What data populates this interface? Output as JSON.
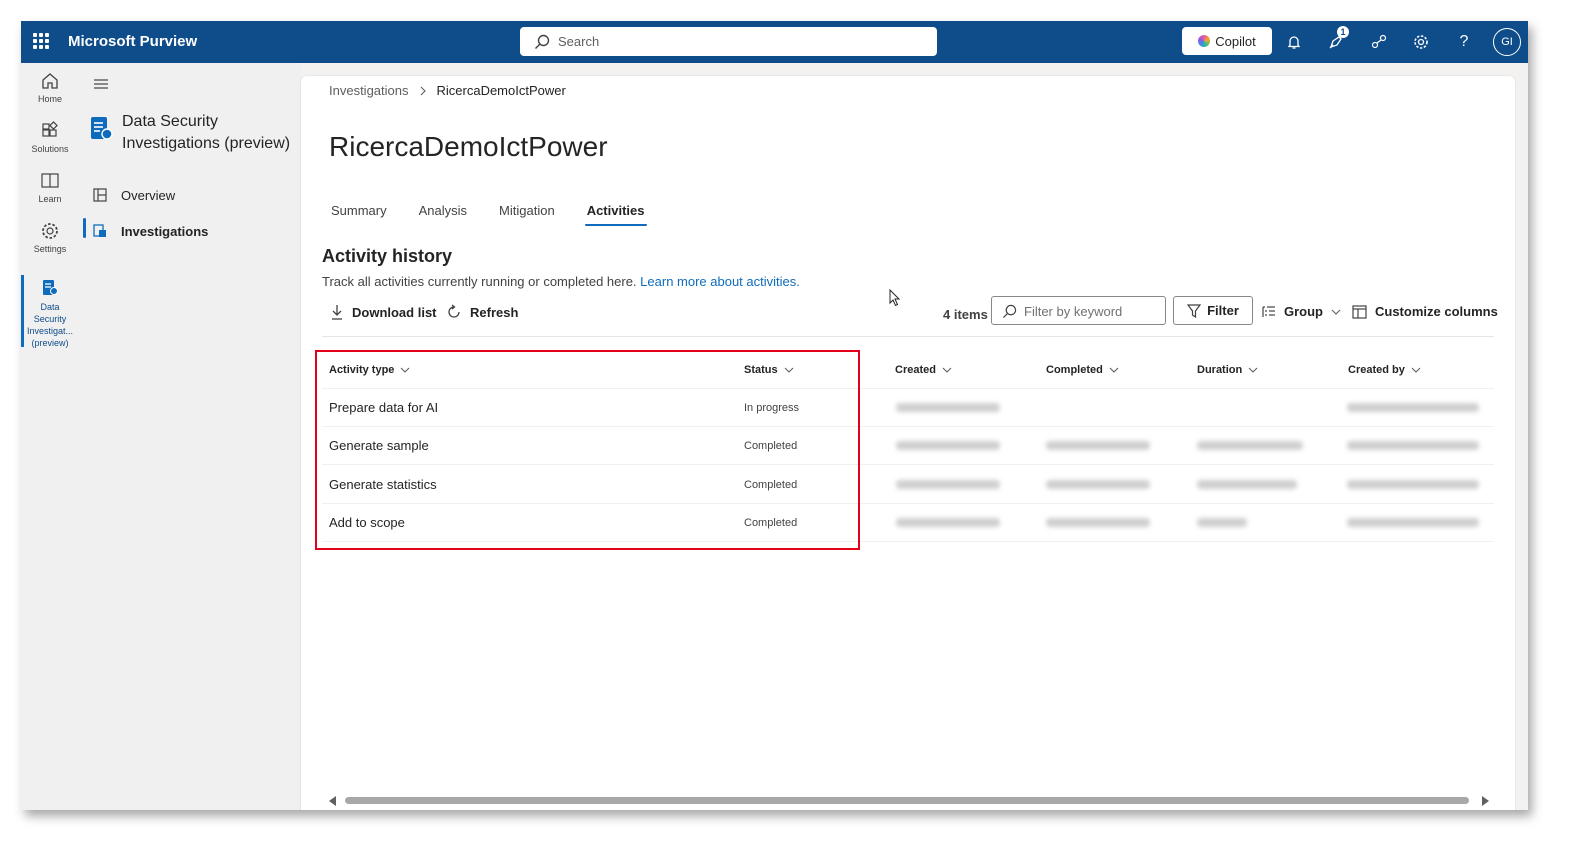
{
  "topbar": {
    "app_title": "Microsoft Purview",
    "search_placeholder": "Search",
    "copilot_label": "Copilot",
    "notification_count": "1",
    "avatar_initials": "GI",
    "color": "#0f4c8a"
  },
  "rail": {
    "items": [
      {
        "label": "Home",
        "icon": "home-icon"
      },
      {
        "label": "Solutions",
        "icon": "solutions-icon"
      },
      {
        "label": "Learn",
        "icon": "book-icon"
      },
      {
        "label": "Settings",
        "icon": "gear-icon"
      },
      {
        "label": "Data Security Investigat... (preview)",
        "icon": "data-security-icon"
      }
    ]
  },
  "nav": {
    "title": "Data Security Investigations (preview)",
    "items": [
      {
        "label": "Overview",
        "icon": "overview-icon"
      },
      {
        "label": "Investigations",
        "icon": "investigations-icon",
        "active": true
      }
    ]
  },
  "breadcrumb": {
    "parent": "Investigations",
    "current": "RicercaDemoIctPower"
  },
  "page": {
    "title": "RicercaDemoIctPower",
    "tabs": [
      {
        "label": "Summary"
      },
      {
        "label": "Analysis"
      },
      {
        "label": "Mitigation"
      },
      {
        "label": "Activities",
        "active": true
      }
    ]
  },
  "activity": {
    "title": "Activity history",
    "description": "Track all activities currently running or completed here.",
    "learn_more": "Learn more about activities.",
    "download_label": "Download list",
    "refresh_label": "Refresh",
    "items_count": "4 items",
    "filter_placeholder": "Filter by keyword",
    "filter_label": "Filter",
    "group_label": "Group",
    "customize_label": "Customize columns",
    "columns": [
      "Activity type",
      "Status",
      "Created",
      "Completed",
      "Duration",
      "Created by"
    ],
    "rows": [
      {
        "activity_type": "Prepare data for AI",
        "status": "In progress",
        "completed_visible": false,
        "duration_visible": false
      },
      {
        "activity_type": "Generate sample",
        "status": "Completed",
        "completed_visible": true,
        "duration_visible": true
      },
      {
        "activity_type": "Generate statistics",
        "status": "Completed",
        "completed_visible": true,
        "duration_visible": true
      },
      {
        "activity_type": "Add to scope",
        "status": "Completed",
        "completed_visible": true,
        "duration_visible": true
      }
    ],
    "highlight_color": "#e3001b",
    "link_color": "#0f6cbd"
  }
}
